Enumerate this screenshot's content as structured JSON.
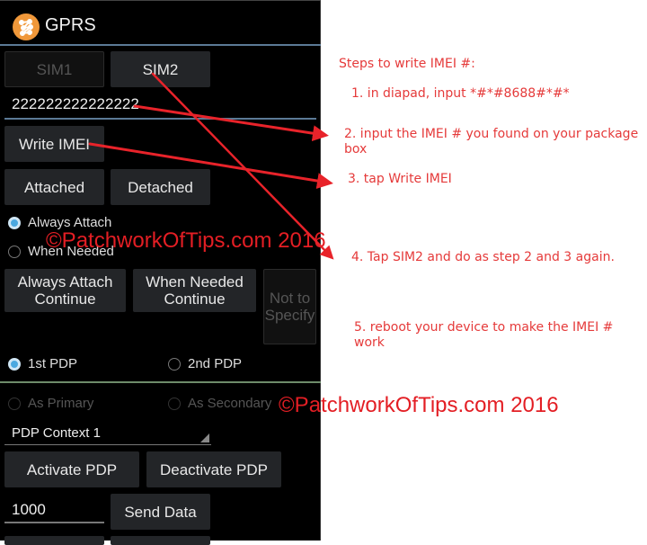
{
  "app": {
    "title": "GPRS",
    "icon": "gprs-app-icon"
  },
  "sim_tabs": [
    {
      "label": "SIM1",
      "state": "disabled"
    },
    {
      "label": "SIM2",
      "state": "selected"
    }
  ],
  "imei_field": {
    "value": "222222222222222"
  },
  "buttons": {
    "write_imei": "Write IMEI",
    "attached": "Attached",
    "detached": "Detached",
    "always_attach_continue": "Always Attach Continue",
    "when_needed_continue": "When Needed Continue",
    "not_to_specify": "Not to Specify",
    "activate_pdp": "Activate PDP",
    "deactivate_pdp": "Deactivate PDP",
    "send_data": "Send Data"
  },
  "attach_mode": {
    "options": [
      "Always Attach",
      "When Needed"
    ],
    "selected": "Always Attach"
  },
  "pdp": {
    "options": [
      "1st PDP",
      "2nd PDP"
    ],
    "selected": "1st PDP",
    "role_options": [
      "As Primary",
      "As Secondary"
    ],
    "context": "PDP Context 1"
  },
  "data_field": {
    "value": "1000"
  },
  "instructions": {
    "heading": "Steps to write IMEI #:",
    "step1": "1. in diapad, input *#*#8688#*#*",
    "step2": "2. input the IMEI # you found on your package box",
    "step3": "3. tap Write IMEI",
    "step4": "4. Tap SIM2 and do as step 2 and 3 again.",
    "step5": "5. reboot your device to make the IMEI # work"
  },
  "watermark": "©PatchworkOfTips.com 2016",
  "colors": {
    "annotation_red": "#e53a3a",
    "accent_blue": "#4aa8e0",
    "icon_orange": "#f0983a"
  }
}
